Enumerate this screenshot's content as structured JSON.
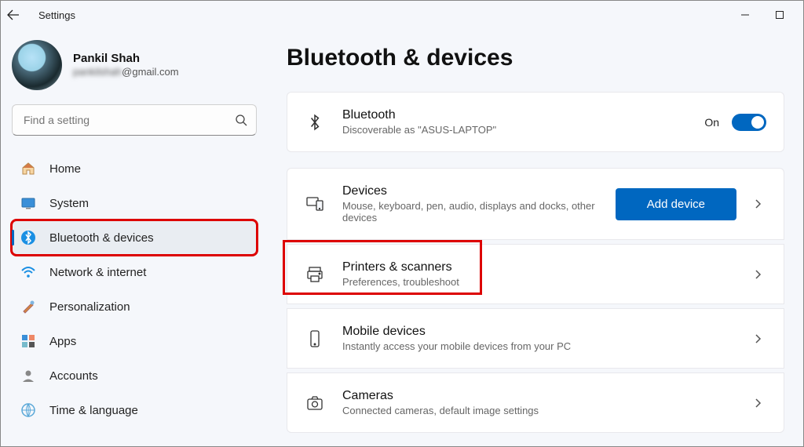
{
  "window": {
    "title": "Settings"
  },
  "profile": {
    "name": "Pankil Shah",
    "email_hidden": "pankilshah",
    "email_domain": "@gmail.com"
  },
  "search": {
    "placeholder": "Find a setting"
  },
  "sidebar": {
    "items": [
      {
        "label": "Home"
      },
      {
        "label": "System"
      },
      {
        "label": "Bluetooth & devices"
      },
      {
        "label": "Network & internet"
      },
      {
        "label": "Personalization"
      },
      {
        "label": "Apps"
      },
      {
        "label": "Accounts"
      },
      {
        "label": "Time & language"
      }
    ]
  },
  "page": {
    "title": "Bluetooth & devices"
  },
  "bluetooth": {
    "title": "Bluetooth",
    "sub": "Discoverable as \"ASUS-LAPTOP\"",
    "toggle_label": "On"
  },
  "devices": {
    "title": "Devices",
    "sub": "Mouse, keyboard, pen, audio, displays and docks, other devices",
    "add_button": "Add device"
  },
  "printers": {
    "title": "Printers & scanners",
    "sub": "Preferences, troubleshoot"
  },
  "mobile": {
    "title": "Mobile devices",
    "sub": "Instantly access your mobile devices from your PC"
  },
  "cameras": {
    "title": "Cameras",
    "sub": "Connected cameras, default image settings"
  }
}
